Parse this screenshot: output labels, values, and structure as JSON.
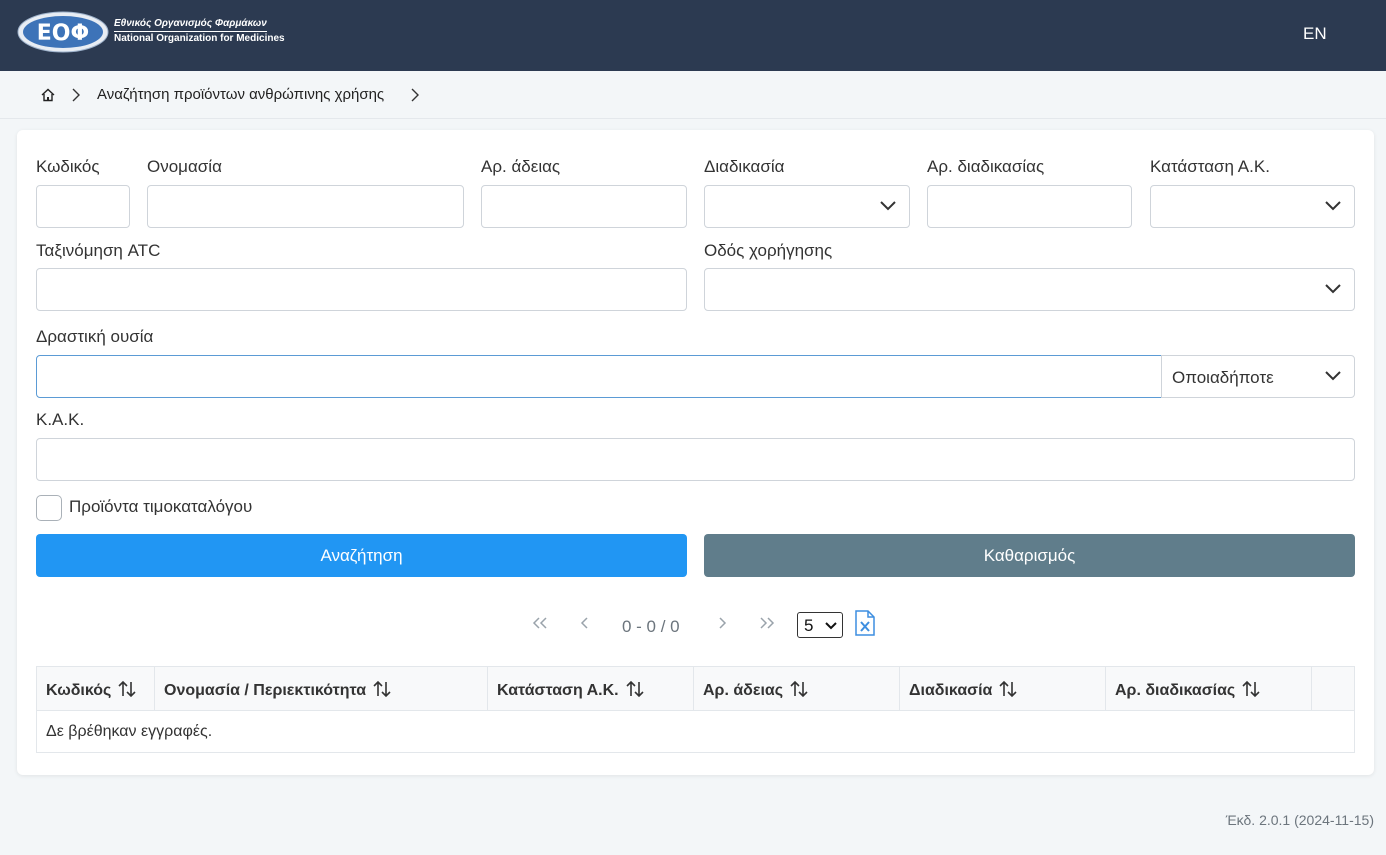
{
  "header": {
    "logo_letters": "ΕΟΦ",
    "org_name_el": "Εθνικός Οργανισμός Φαρμάκων",
    "org_name_en": "National Organization for Medicines",
    "language_toggle": "EN"
  },
  "breadcrumb": {
    "current": "Αναζήτηση προϊόντων ανθρώπινης χρήσης"
  },
  "form": {
    "code_label": "Κωδικός",
    "name_label": "Ονομασία",
    "license_no_label": "Αρ. άδειας",
    "procedure_label": "Διαδικασία",
    "procedure_no_label": "Αρ. διαδικασίας",
    "ma_status_label": "Κατάσταση Α.Κ.",
    "atc_label": "Ταξινόμηση ATC",
    "route_label": "Οδός χορήγησης",
    "active_substance_label": "Δραστική ουσία",
    "substance_match_value": "Οποιαδήποτε",
    "mah_label": "Κ.Α.Κ.",
    "price_list_label": "Προϊόντα τιμοκαταλόγου",
    "search_button": "Αναζήτηση",
    "clear_button": "Καθαρισμός"
  },
  "pager": {
    "range_text": "0 - 0 / 0",
    "page_size": "5"
  },
  "table": {
    "columns": [
      "Κωδικός",
      "Ονομασία / Περιεκτικότητα",
      "Κατάσταση Α.Κ.",
      "Αρ. άδειας",
      "Διαδικασία",
      "Αρ. διαδικασίας"
    ],
    "empty_message": "Δε βρέθηκαν εγγραφές."
  },
  "footer": {
    "version": "Έκδ. 2.0.1 (2024-11-15)"
  },
  "colors": {
    "header_bg": "#2c3a51",
    "primary": "#2196f3",
    "secondary": "#607d8b"
  }
}
